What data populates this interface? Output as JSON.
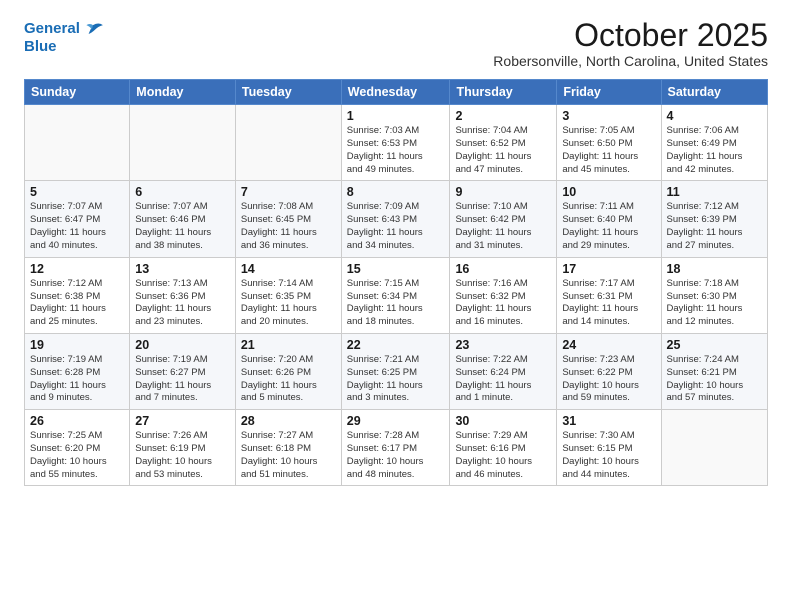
{
  "header": {
    "logo_line1": "General",
    "logo_line2": "Blue",
    "title": "October 2025",
    "subtitle": "Robersonville, North Carolina, United States"
  },
  "days_of_week": [
    "Sunday",
    "Monday",
    "Tuesday",
    "Wednesday",
    "Thursday",
    "Friday",
    "Saturday"
  ],
  "weeks": [
    [
      {
        "num": "",
        "info": ""
      },
      {
        "num": "",
        "info": ""
      },
      {
        "num": "",
        "info": ""
      },
      {
        "num": "1",
        "info": "Sunrise: 7:03 AM\nSunset: 6:53 PM\nDaylight: 11 hours\nand 49 minutes."
      },
      {
        "num": "2",
        "info": "Sunrise: 7:04 AM\nSunset: 6:52 PM\nDaylight: 11 hours\nand 47 minutes."
      },
      {
        "num": "3",
        "info": "Sunrise: 7:05 AM\nSunset: 6:50 PM\nDaylight: 11 hours\nand 45 minutes."
      },
      {
        "num": "4",
        "info": "Sunrise: 7:06 AM\nSunset: 6:49 PM\nDaylight: 11 hours\nand 42 minutes."
      }
    ],
    [
      {
        "num": "5",
        "info": "Sunrise: 7:07 AM\nSunset: 6:47 PM\nDaylight: 11 hours\nand 40 minutes."
      },
      {
        "num": "6",
        "info": "Sunrise: 7:07 AM\nSunset: 6:46 PM\nDaylight: 11 hours\nand 38 minutes."
      },
      {
        "num": "7",
        "info": "Sunrise: 7:08 AM\nSunset: 6:45 PM\nDaylight: 11 hours\nand 36 minutes."
      },
      {
        "num": "8",
        "info": "Sunrise: 7:09 AM\nSunset: 6:43 PM\nDaylight: 11 hours\nand 34 minutes."
      },
      {
        "num": "9",
        "info": "Sunrise: 7:10 AM\nSunset: 6:42 PM\nDaylight: 11 hours\nand 31 minutes."
      },
      {
        "num": "10",
        "info": "Sunrise: 7:11 AM\nSunset: 6:40 PM\nDaylight: 11 hours\nand 29 minutes."
      },
      {
        "num": "11",
        "info": "Sunrise: 7:12 AM\nSunset: 6:39 PM\nDaylight: 11 hours\nand 27 minutes."
      }
    ],
    [
      {
        "num": "12",
        "info": "Sunrise: 7:12 AM\nSunset: 6:38 PM\nDaylight: 11 hours\nand 25 minutes."
      },
      {
        "num": "13",
        "info": "Sunrise: 7:13 AM\nSunset: 6:36 PM\nDaylight: 11 hours\nand 23 minutes."
      },
      {
        "num": "14",
        "info": "Sunrise: 7:14 AM\nSunset: 6:35 PM\nDaylight: 11 hours\nand 20 minutes."
      },
      {
        "num": "15",
        "info": "Sunrise: 7:15 AM\nSunset: 6:34 PM\nDaylight: 11 hours\nand 18 minutes."
      },
      {
        "num": "16",
        "info": "Sunrise: 7:16 AM\nSunset: 6:32 PM\nDaylight: 11 hours\nand 16 minutes."
      },
      {
        "num": "17",
        "info": "Sunrise: 7:17 AM\nSunset: 6:31 PM\nDaylight: 11 hours\nand 14 minutes."
      },
      {
        "num": "18",
        "info": "Sunrise: 7:18 AM\nSunset: 6:30 PM\nDaylight: 11 hours\nand 12 minutes."
      }
    ],
    [
      {
        "num": "19",
        "info": "Sunrise: 7:19 AM\nSunset: 6:28 PM\nDaylight: 11 hours\nand 9 minutes."
      },
      {
        "num": "20",
        "info": "Sunrise: 7:19 AM\nSunset: 6:27 PM\nDaylight: 11 hours\nand 7 minutes."
      },
      {
        "num": "21",
        "info": "Sunrise: 7:20 AM\nSunset: 6:26 PM\nDaylight: 11 hours\nand 5 minutes."
      },
      {
        "num": "22",
        "info": "Sunrise: 7:21 AM\nSunset: 6:25 PM\nDaylight: 11 hours\nand 3 minutes."
      },
      {
        "num": "23",
        "info": "Sunrise: 7:22 AM\nSunset: 6:24 PM\nDaylight: 11 hours\nand 1 minute."
      },
      {
        "num": "24",
        "info": "Sunrise: 7:23 AM\nSunset: 6:22 PM\nDaylight: 10 hours\nand 59 minutes."
      },
      {
        "num": "25",
        "info": "Sunrise: 7:24 AM\nSunset: 6:21 PM\nDaylight: 10 hours\nand 57 minutes."
      }
    ],
    [
      {
        "num": "26",
        "info": "Sunrise: 7:25 AM\nSunset: 6:20 PM\nDaylight: 10 hours\nand 55 minutes."
      },
      {
        "num": "27",
        "info": "Sunrise: 7:26 AM\nSunset: 6:19 PM\nDaylight: 10 hours\nand 53 minutes."
      },
      {
        "num": "28",
        "info": "Sunrise: 7:27 AM\nSunset: 6:18 PM\nDaylight: 10 hours\nand 51 minutes."
      },
      {
        "num": "29",
        "info": "Sunrise: 7:28 AM\nSunset: 6:17 PM\nDaylight: 10 hours\nand 48 minutes."
      },
      {
        "num": "30",
        "info": "Sunrise: 7:29 AM\nSunset: 6:16 PM\nDaylight: 10 hours\nand 46 minutes."
      },
      {
        "num": "31",
        "info": "Sunrise: 7:30 AM\nSunset: 6:15 PM\nDaylight: 10 hours\nand 44 minutes."
      },
      {
        "num": "",
        "info": ""
      }
    ]
  ]
}
